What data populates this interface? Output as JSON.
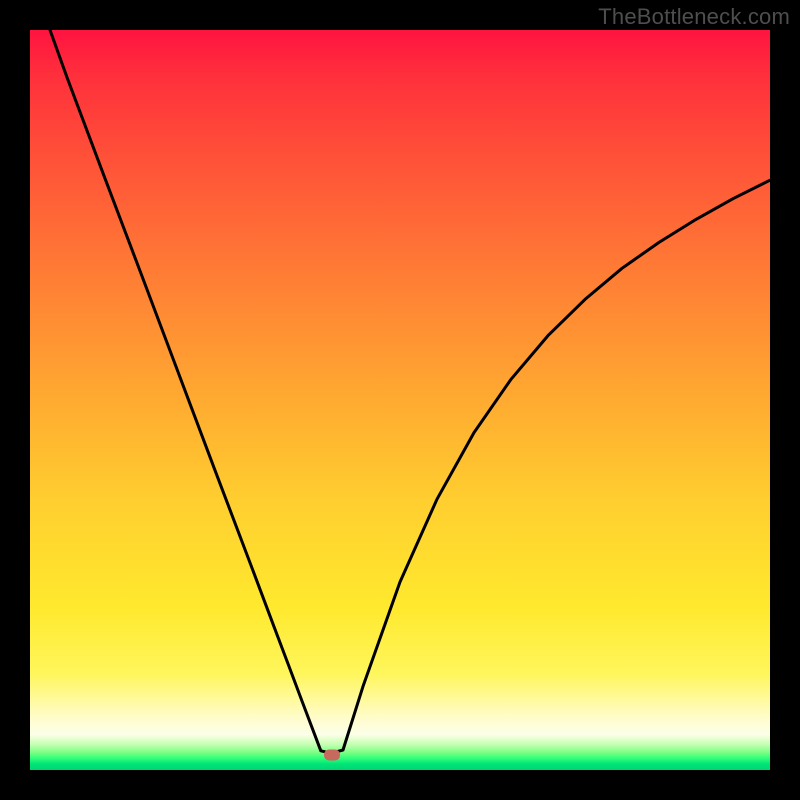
{
  "watermark": "TheBottleneck.com",
  "chart_data": {
    "type": "line",
    "title": "",
    "xlabel": "",
    "ylabel": "",
    "xlim": [
      0,
      100
    ],
    "ylim": [
      0,
      100
    ],
    "notes": "Axes unlabeled; values are relative percentages inferred from pixel position. y=0 at bottom. Curve is a V-shaped notch with minimum near the marker.",
    "series": [
      {
        "name": "bottleneck-curve",
        "x": [
          2.7,
          5,
          10,
          15,
          20,
          25,
          30,
          33,
          35,
          36.8,
          38.5,
          39.3,
          40.1,
          41.2,
          42.3,
          45,
          50,
          55,
          60,
          65,
          70,
          75,
          80,
          85,
          90,
          95,
          100
        ],
        "y": [
          100,
          93.6,
          80.3,
          67.1,
          53.8,
          40.5,
          27.3,
          19.3,
          14.0,
          9.2,
          4.7,
          2.6,
          2.4,
          2.4,
          2.7,
          11.3,
          25.4,
          36.6,
          45.6,
          52.8,
          58.7,
          63.6,
          67.8,
          71.3,
          74.4,
          77.2,
          79.7
        ]
      }
    ],
    "marker": {
      "x": 40.8,
      "y": 2.0,
      "color": "#c76a5d",
      "shape": "rounded-rect"
    },
    "gradient_stops": [
      {
        "pos": 0.0,
        "color": "#ff1340"
      },
      {
        "pos": 0.17,
        "color": "#ff5038"
      },
      {
        "pos": 0.48,
        "color": "#ffa531"
      },
      {
        "pos": 0.78,
        "color": "#ffe92e"
      },
      {
        "pos": 0.93,
        "color": "#fffccc"
      },
      {
        "pos": 0.98,
        "color": "#32ff7a"
      },
      {
        "pos": 1.0,
        "color": "#00d477"
      }
    ]
  }
}
